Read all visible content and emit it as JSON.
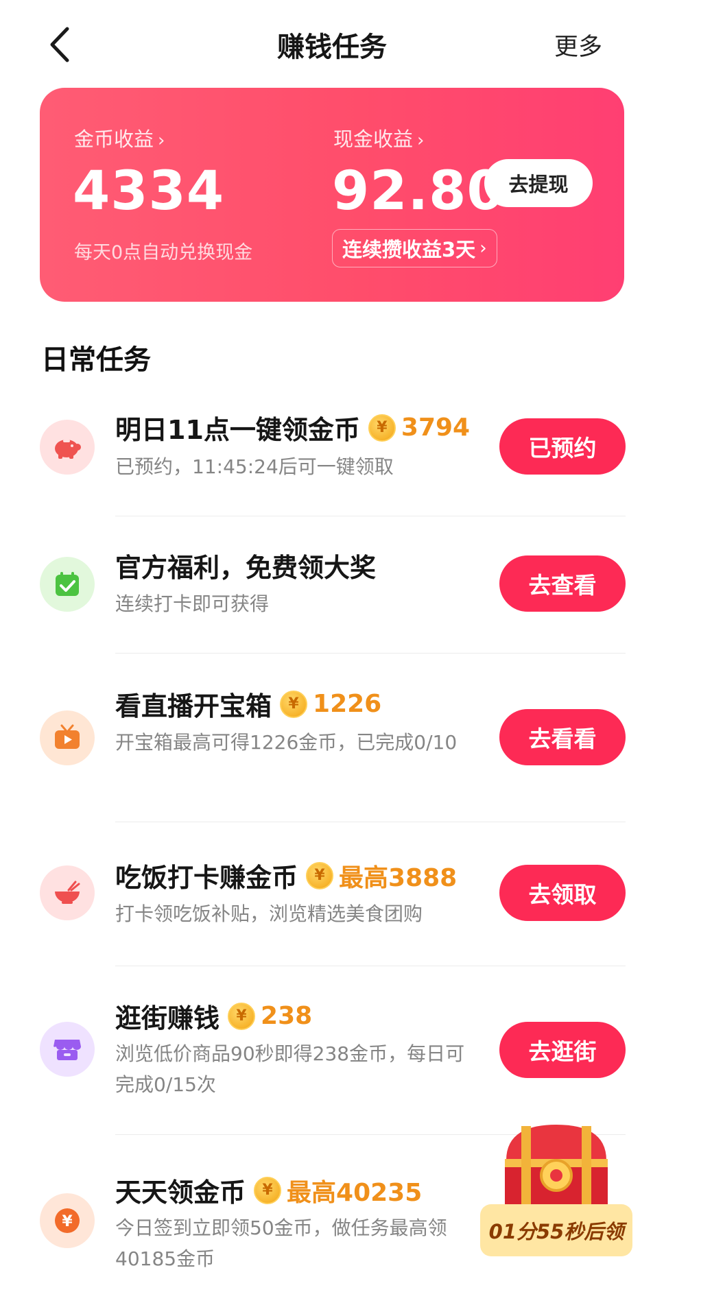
{
  "header": {
    "title": "赚钱任务",
    "more_label": "更多"
  },
  "earnings": {
    "coin_label": "金币收益",
    "coin_value": "4334",
    "coin_note": "每天0点自动兑换现金",
    "cash_label": "现金收益",
    "cash_value": "92.80",
    "withdraw_label": "去提现",
    "streak_label": "连续攒收益3天",
    "chevron": "›",
    "accent_color": "#ff4d6b"
  },
  "daily": {
    "section_title": "日常任务",
    "tasks": [
      {
        "title": "明日11点一键领金币",
        "reward": "3794",
        "subtitle": "已预约，11:45:24后可一键领取",
        "button": "已预约",
        "icon": "piggy-bank-icon",
        "icon_color": "#ef5350"
      },
      {
        "title": "官方福利，免费领大奖",
        "reward": "",
        "subtitle": "连续打卡即可获得",
        "button": "去查看",
        "icon": "calendar-check-icon",
        "icon_color": "#4cc341"
      },
      {
        "title": "看直播开宝箱",
        "reward": "1226",
        "subtitle": "开宝箱最高可得1226金币，已完成0/10",
        "button": "去看看",
        "icon": "tv-icon",
        "icon_color": "#f2812e"
      },
      {
        "title": "吃饭打卡赚金币",
        "reward": "最高3888",
        "subtitle": "打卡领吃饭补贴，浏览精选美食团购",
        "button": "去领取",
        "icon": "rice-bowl-icon",
        "icon_color": "#ef4f4f"
      },
      {
        "title": "逛街赚钱",
        "reward": "238",
        "subtitle": "浏览低价商品90秒即得238金币，每日可完成0/15次",
        "button": "去逛街",
        "icon": "store-icon",
        "icon_color": "#9a5cf0"
      },
      {
        "title": "天天领金币",
        "reward": "最高40235",
        "subtitle": "今日签到立即领50金币，做任务最高领40185金币",
        "button": "",
        "icon": "yuan-coin-icon",
        "icon_color": "#f26b2a"
      }
    ]
  },
  "chest": {
    "timer": "01分55秒后领",
    "icon": "treasure-chest-icon"
  },
  "colors": {
    "button": "#fd2a55",
    "reward": "#f0901a",
    "coin": "#f7b42c"
  }
}
